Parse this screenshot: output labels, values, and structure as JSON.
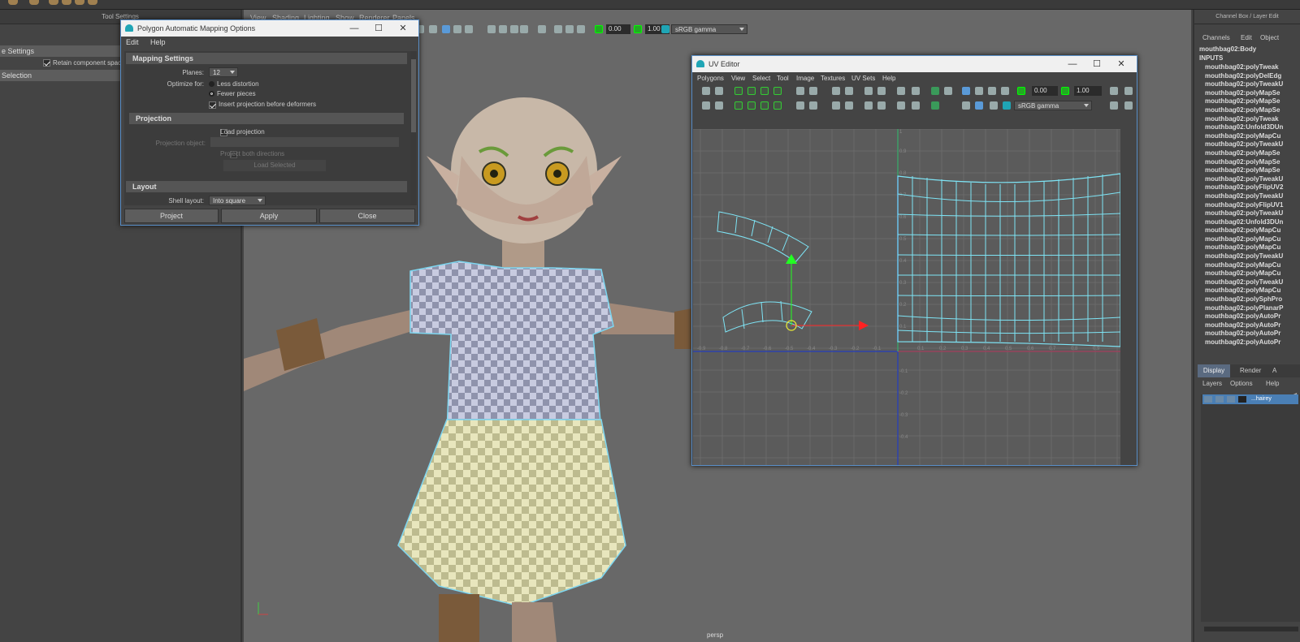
{
  "tool_settings": {
    "header": "Tool Settings",
    "section1": "e Settings",
    "retain_label": "Retain component spaci",
    "section2": "Selection"
  },
  "viewport": {
    "menu": [
      "View",
      "Shading",
      "Lighting",
      "Show",
      "Renderer",
      "Panels"
    ],
    "val1": "0.00",
    "val2": "1.00",
    "colorspace": "sRGB gamma",
    "camera": "persp"
  },
  "dialog": {
    "title": "Polygon Automatic Mapping Options",
    "menu": [
      "Edit",
      "Help"
    ],
    "sec_mapping": "Mapping Settings",
    "planes_label": "Planes:",
    "planes_value": "12",
    "optimize_label": "Optimize for:",
    "opt_less": "Less distortion",
    "opt_fewer": "Fewer pieces",
    "insert_label": "Insert projection before deformers",
    "sec_projection": "Projection",
    "load_proj": "Load projection",
    "proj_obj_label": "Projection object:",
    "proj_both": "Project both directions",
    "load_selected": "Load Selected",
    "sec_layout": "Layout",
    "shell_label": "Shell layout:",
    "shell_value": "Into square",
    "btn_project": "Project",
    "btn_apply": "Apply",
    "btn_close": "Close"
  },
  "uv_editor": {
    "title": "UV Editor",
    "menu": [
      "Polygons",
      "View",
      "Select",
      "Tool",
      "Image",
      "Textures",
      "UV Sets",
      "Help"
    ],
    "val1": "0.00",
    "val2": "1.00",
    "colorspace": "sRGB gamma",
    "x_ticks": [
      "-0.9",
      "-0.8",
      "-0.7",
      "-0.6",
      "-0.5",
      "-0.4",
      "-0.3",
      "-0.2",
      "-0.1",
      "0.1",
      "0.2",
      "0.3",
      "0.4",
      "0.5",
      "0.6",
      "0.7",
      "0.8",
      "0.9"
    ],
    "y_ticks": [
      "1",
      "0.9",
      "0.8",
      "0.7",
      "0.6",
      "0.5",
      "0.4",
      "0.3",
      "0.2",
      "0.1",
      "-0.1",
      "-0.2",
      "-0.3",
      "-0.4"
    ]
  },
  "channel_box": {
    "header": "Channel Box / Layer Edit",
    "menu": [
      "Channels",
      "Edit",
      "Object"
    ],
    "object": "mouthbag02:Body",
    "inputs": "INPUTS",
    "items": [
      "mouthbag02:polyTweak",
      "mouthbag02:polyDelEdg",
      "mouthbag02:polyTweakU",
      "mouthbag02:polyMapSe",
      "mouthbag02:polyMapSe",
      "mouthbag02:polyMapSe",
      "mouthbag02:polyTweak",
      "mouthbag02:Unfold3DUn",
      "mouthbag02:polyMapCu",
      "mouthbag02:polyTweakU",
      "mouthbag02:polyMapSe",
      "mouthbag02:polyMapSe",
      "mouthbag02:polyMapSe",
      "mouthbag02:polyTweakU",
      "mouthbag02:polyFlipUV2",
      "mouthbag02:polyTweakU",
      "mouthbag02:polyFlipUV1",
      "mouthbag02:polyTweakU",
      "mouthbag02:Unfold3DUn",
      "mouthbag02:polyMapCu",
      "mouthbag02:polyMapCu",
      "mouthbag02:polyMapCu",
      "mouthbag02:polyTweakU",
      "mouthbag02:polyMapCu",
      "mouthbag02:polyMapCu",
      "mouthbag02:polyTweakU",
      "mouthbag02:polyMapCu",
      "mouthbag02:polySphPro",
      "mouthbag02:polyPlanarP",
      "mouthbag02:polyAutoPr",
      "mouthbag02:polyAutoPr",
      "mouthbag02:polyAutoPr",
      "mouthbag02:polyAutoPr"
    ],
    "tabs": [
      "Display",
      "Render",
      "A"
    ],
    "layer_menu": [
      "Layers",
      "Options",
      "Help"
    ],
    "layer_name": "...hairey"
  }
}
